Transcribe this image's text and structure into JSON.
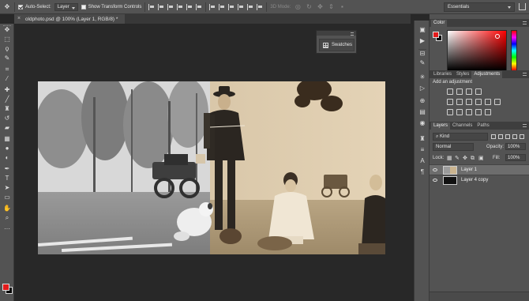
{
  "options_bar": {
    "auto_select_label": "Auto-Select:",
    "auto_select_checked": true,
    "auto_select_target": "Layer",
    "transform_controls_label": "Show Transform Controls",
    "transform_controls_checked": false,
    "mode_3d_label": "3D Mode:",
    "workspace": "Essentials"
  },
  "document": {
    "tab_title": "oldphoto.psd @ 100% (Layer 1, RGB/8) *",
    "close_glyph": "×"
  },
  "tools": [
    {
      "name": "move-tool-icon",
      "glyph": "✥"
    },
    {
      "name": "marquee-tool-icon",
      "glyph": "⬚"
    },
    {
      "name": "lasso-tool-icon",
      "glyph": "ϙ"
    },
    {
      "name": "quick-select-tool-icon",
      "glyph": "✎"
    },
    {
      "name": "crop-tool-icon",
      "glyph": "⌗"
    },
    {
      "name": "eyedropper-tool-icon",
      "glyph": "⁄"
    },
    {
      "name": "healing-brush-tool-icon",
      "glyph": "✚"
    },
    {
      "name": "brush-tool-icon",
      "glyph": "╱"
    },
    {
      "name": "clone-stamp-tool-icon",
      "glyph": "♜"
    },
    {
      "name": "history-brush-tool-icon",
      "glyph": "↺"
    },
    {
      "name": "eraser-tool-icon",
      "glyph": "▰"
    },
    {
      "name": "gradient-tool-icon",
      "glyph": "▦"
    },
    {
      "name": "blur-tool-icon",
      "glyph": "●"
    },
    {
      "name": "dodge-tool-icon",
      "glyph": "◐"
    },
    {
      "name": "pen-tool-icon",
      "glyph": "✒"
    },
    {
      "name": "type-tool-icon",
      "glyph": "T"
    },
    {
      "name": "path-select-tool-icon",
      "glyph": "➤"
    },
    {
      "name": "shape-tool-icon",
      "glyph": "▭"
    },
    {
      "name": "hand-tool-icon",
      "glyph": "✋"
    },
    {
      "name": "zoom-tool-icon",
      "glyph": "⌕"
    },
    {
      "name": "more-tools-icon",
      "glyph": "···"
    }
  ],
  "swatches_panel": {
    "label": "Swatches"
  },
  "color_panel": {
    "tab": "Color",
    "foreground": "#e31b1b",
    "background": "#050505"
  },
  "adjustments_panel": {
    "tabs": [
      "Libraries",
      "Styles",
      "Adjustments"
    ],
    "active_tab": "Adjustments",
    "title": "Add an adjustment"
  },
  "layers_panel": {
    "tabs": [
      "Layers",
      "Channels",
      "Paths"
    ],
    "active_tab": "Layers",
    "filter": "Kind",
    "blend_mode": "Normal",
    "opacity_label": "Opacity:",
    "opacity_value": "100%",
    "lock_label": "Lock:",
    "fill_label": "Fill:",
    "fill_value": "100%",
    "layers": [
      {
        "name": "Layer 1",
        "selected": true,
        "visible": true
      },
      {
        "name": "Layer 4 copy",
        "selected": false,
        "visible": true
      }
    ]
  }
}
